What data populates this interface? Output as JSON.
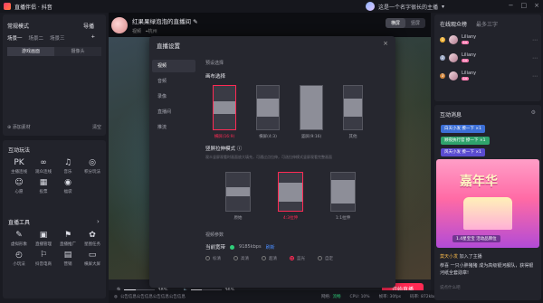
{
  "app": {
    "title": "直播伴侣 · 抖音"
  },
  "topbar": {
    "user_text": "这是一个名字很长的主播",
    "window_buttons": [
      "−",
      "□",
      "×"
    ]
  },
  "left": {
    "mode": "常规模式",
    "import": "导播",
    "scenes": [
      "场景一",
      "场景二",
      "场景三"
    ],
    "sources": [
      "游戏画面",
      "摄像头"
    ],
    "add_material": "添加素材",
    "clear": "清空"
  },
  "interactive": {
    "title": "互动玩法",
    "items": [
      {
        "icon": "PK",
        "label": "主播连线"
      },
      {
        "icon": "∞",
        "label": "观众连线"
      },
      {
        "icon": "♫",
        "label": "音乐"
      },
      {
        "icon": "◎",
        "label": "积分玩法"
      },
      {
        "icon": "☺",
        "label": "心愿"
      },
      {
        "icon": "▦",
        "label": "投票"
      },
      {
        "icon": "◉",
        "label": "福袋"
      }
    ]
  },
  "tools": {
    "title": "直播工具",
    "more": "›",
    "items": [
      {
        "icon": "✎",
        "label": "虚拟形象"
      },
      {
        "icon": "▣",
        "label": "直播管理"
      },
      {
        "icon": "⚑",
        "label": "直播推广"
      },
      {
        "icon": "✿",
        "label": "星图任务"
      },
      {
        "icon": "◴",
        "label": "小玩法"
      },
      {
        "icon": "⚐",
        "label": "抖音电商"
      },
      {
        "icon": "▤",
        "label": "营销"
      },
      {
        "icon": "▭",
        "label": "横屏大屏"
      }
    ]
  },
  "streamer": {
    "title": "红果果绿泡泡的直播间",
    "sub": "视频",
    "location": "杭州"
  },
  "orientation": {
    "options": [
      "横屏",
      "竖屏"
    ],
    "active": 0
  },
  "bottombar": {
    "mic_value": "38%",
    "speaker_value": "36%",
    "mic_level": 0.38,
    "speaker_level": 0.36,
    "start_label": "开始直播"
  },
  "statusbar": {
    "notice": "公告信息公告信息公告信息公告信息",
    "network_label": "网络:",
    "network_value": "流畅",
    "cpu": "CPU: 10%",
    "fps": "帧率: 30fps",
    "bitrate": "码率: 872kb/s"
  },
  "modal": {
    "title": "直播设置",
    "nav": [
      "视频",
      "音频",
      "录像",
      "直播间",
      "推流"
    ],
    "nav_active": 0,
    "preset_label": "预设选择",
    "ratio_title": "画布选择",
    "ratios": [
      {
        "label": "横屏(16:9)",
        "selected": true
      },
      {
        "label": "横屏(4:3)",
        "selected": false
      },
      {
        "label": "竖屏(9:16)",
        "selected": false
      },
      {
        "label": "其他",
        "selected": false
      }
    ],
    "stretch_title": "竖屏拉伸模式 ⓘ",
    "stretch_hint": "观众竖屏观看时画面放大填充，可通过点拉伸，可选拉伸模式竖屏观看完整画面",
    "stretch_options": [
      {
        "label": "原始",
        "selected": false
      },
      {
        "label": "4:3拉伸",
        "selected": true
      },
      {
        "label": "1:1拉伸",
        "selected": false
      }
    ],
    "params_label": "视频参数",
    "quality_label": "当前宽带",
    "quality_value": "9185kbps",
    "refresh_label": "刷新",
    "quality_options": [
      "标清",
      "高清",
      "超清",
      "蓝光",
      "自定"
    ],
    "quality_active": 3
  },
  "audience": {
    "tabs": [
      "在线观众榜",
      "最多三字"
    ],
    "rows": [
      {
        "rank": "1",
        "name": "Liliany",
        "level": "Lv"
      },
      {
        "rank": "2",
        "name": "Liliany",
        "level": "Lv"
      },
      {
        "rank": "3",
        "name": "Liliany",
        "level": "Lv"
      }
    ],
    "rank_colors": [
      "#f2b53a",
      "#9aa7c4",
      "#d4883e"
    ]
  },
  "messages": {
    "title": "互动消息",
    "chips": [
      {
        "text": "白天小发  撩一下  ×1",
        "color": "#3c6fd6"
      },
      {
        "text": "顾夜执行官  撩一下  ×1",
        "color": "#2fa36c"
      },
      {
        "text": "风天小发  撩一下  ×1",
        "color": "#5a4bd0"
      },
      {
        "text": "白天小发  撩一下  ×1",
        "color": "#3c6fd6"
      }
    ],
    "promo_text": "嘉年华",
    "promo_label": "1.4星宝宝  活动品牌位",
    "lines": [
      {
        "user": "莫天小发",
        "text": "加入了主播"
      },
      {
        "user": "恭喜",
        "text": "一只小胖猪猪 成为高级银河舰队，获得银河纸全套勋章!"
      }
    ],
    "input_placeholder": "说点什么吧"
  }
}
